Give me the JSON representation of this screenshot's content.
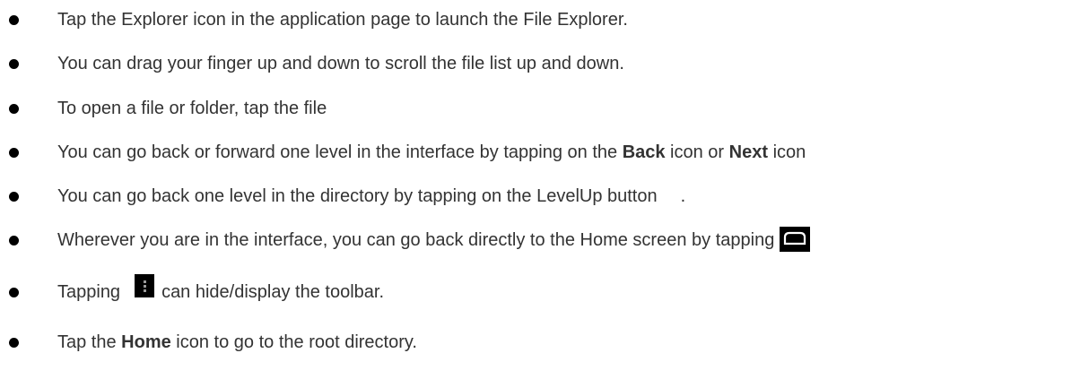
{
  "bullets": [
    {
      "text": "Tap the Explorer icon in the application page to launch the File Explorer."
    },
    {
      "text": "You can drag your finger up and down to scroll the file list up and down."
    },
    {
      "text": "To open a file or folder, tap the file"
    },
    {
      "prefix": "You can go back or forward one level in the interface by tapping on the ",
      "bold1": "Back",
      "middle": " icon or ",
      "bold2": "Next",
      "suffix": " icon"
    },
    {
      "prefix": "You can go back one level in the directory by tapping on the LevelUp button",
      "suffix": "."
    },
    {
      "text": "Wherever you are in the interface, you can go back directly to the Home screen by tapping",
      "icon": "home-icon"
    },
    {
      "prefix": "Tapping",
      "suffix": "can hide/display the toolbar.",
      "icon": "menu-icon"
    },
    {
      "prefix": "Tap the ",
      "bold": "Home",
      "suffix": " icon to go to the root directory."
    }
  ],
  "colors": {
    "text": "#333333",
    "bullet": "#000000",
    "icon_bg": "#000000",
    "icon_stroke": "#ffffff"
  }
}
